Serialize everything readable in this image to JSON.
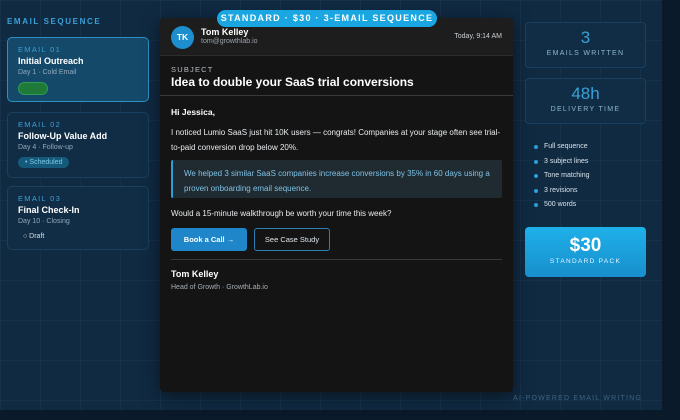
{
  "sidebar": {
    "title": "EMAIL SEQUENCE",
    "items": [
      {
        "label": "EMAIL 01",
        "name": "Initial Outreach",
        "meta": "Day 1 · Cold Email",
        "status": "Sent"
      },
      {
        "label": "EMAIL 02",
        "name": "Follow-Up Value Add",
        "meta": "Day 4 · Follow-up",
        "status": "• Scheduled"
      },
      {
        "label": "EMAIL 03",
        "name": "Final Check-In",
        "meta": "Day 10 · Closing",
        "status": "○ Draft"
      }
    ]
  },
  "top_banner": "STANDARD · $30 · 3-EMAIL SEQUENCE",
  "email": {
    "avatar_initials": "TK",
    "sender_name": "Tom Kelley",
    "sender_email": "tom@growthlab.io",
    "timestamp": "Today, 9:14 AM",
    "subject_label": "SUBJECT",
    "subject": "Idea to double your SaaS trial conversions",
    "greeting": "Hi Jessica,",
    "paragraph": "I noticed Lumio SaaS just hit 10K users — congrats! Companies at your stage often see trial-to-paid conversion drop below 20%.",
    "quote": "We helped 3 similar SaaS companies increase conversions by 35% in 60 days using a proven onboarding email sequence.",
    "question": "Would a 15-minute walkthrough be worth your time this week?",
    "primary_cta": "Book a Call →",
    "secondary_cta": "See Case Study",
    "signature_name": "Tom Kelley",
    "signature_title": "Head of Growth · GrowthLab.io"
  },
  "stats": [
    {
      "value": "3",
      "label": "EMAILS WRITTEN"
    },
    {
      "value": "48h",
      "label": "DELIVERY TIME"
    }
  ],
  "features": [
    "Full sequence",
    "3 subject lines",
    "Tone matching",
    "3 revisions",
    "500 words"
  ],
  "pricing": {
    "price": "$30",
    "label": "STANDARD PACK"
  },
  "footer_tag": "AI-POWERED EMAIL WRITING",
  "colors": {
    "accent": "#1aa6e0",
    "panel": "#141414",
    "background": "#102a42",
    "sent": "#1f7a3a"
  }
}
